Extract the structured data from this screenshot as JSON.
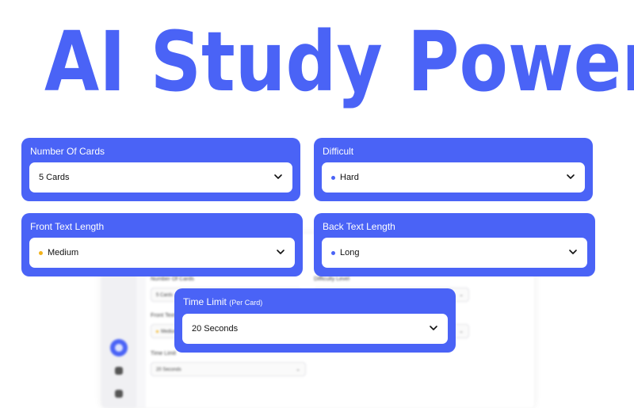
{
  "headline": "AI Study Power",
  "colors": {
    "accent": "#4a63f6",
    "medium_dot": "#f2b21b",
    "blue_dot": "#4a63f6"
  },
  "cards": {
    "number_of_cards": {
      "label": "Number Of Cards",
      "value": "5 Cards"
    },
    "difficult": {
      "label": "Difficult",
      "value": "Hard"
    },
    "front_text_length": {
      "label": "Front Text Length",
      "value": "Medium"
    },
    "back_text_length": {
      "label": "Back Text Length",
      "value": "Long"
    },
    "time_limit": {
      "label": "Time Limit",
      "sublabel": "(Per Card)",
      "value": "20 Seconds"
    }
  },
  "background_window": {
    "number_of_cards_label": "Number Of Cards",
    "number_of_cards_value": "5 Cards",
    "difficulty_label": "Difficulty Level",
    "front_text_label": "Front Text",
    "front_text_value": "Medium",
    "time_limit_label": "Time Limit",
    "time_limit_value": "20 Seconds"
  },
  "icons": [
    "chevron-down-icon",
    "home-icon",
    "list-icon",
    "settings-icon"
  ]
}
